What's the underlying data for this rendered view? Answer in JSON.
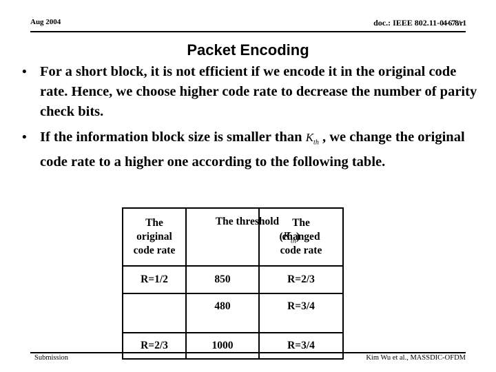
{
  "header": {
    "date": "Aug 2004",
    "doc_prefix": "doc.: IEEE 802.11-",
    "doc_number": "04-678/r1"
  },
  "title": "Packet Encoding",
  "bullets": [
    {
      "marker": "•",
      "text": "For a short block,  it is not efficient if we encode it in the original code rate. Hence,  we choose higher code rate to decrease the number of parity check bits."
    },
    {
      "marker": "•",
      "text_before": "If the information block size  is smaller than ",
      "symbol_base": "K",
      "symbol_sub": "th",
      "text_after": " , we change the original code rate to a higher one according to the following table."
    }
  ],
  "table": {
    "headers": {
      "col1_line1": "The",
      "col1_line2": "original",
      "col1_line3": "code rate",
      "col2_line1": "The threshold",
      "col2_paren_open": "(",
      "col2_symbol_base": "K",
      "col2_symbol_sub": "th",
      "col2_paren_close": ")",
      "col3_line1": "The",
      "col3_line2": "changed",
      "col3_line3": "code rate"
    },
    "rows": [
      {
        "original_rate": "R=1/2",
        "threshold": "850",
        "changed_rate": "R=2/3"
      },
      {
        "original_rate": "",
        "threshold": "480",
        "changed_rate": "R=3/4"
      },
      {
        "original_rate": "R=2/3",
        "threshold": "1000",
        "changed_rate": "R=3/4"
      }
    ]
  },
  "footer": {
    "left": "Submission",
    "right": "Kim Wu et al., MASSDIC-OFDM"
  }
}
